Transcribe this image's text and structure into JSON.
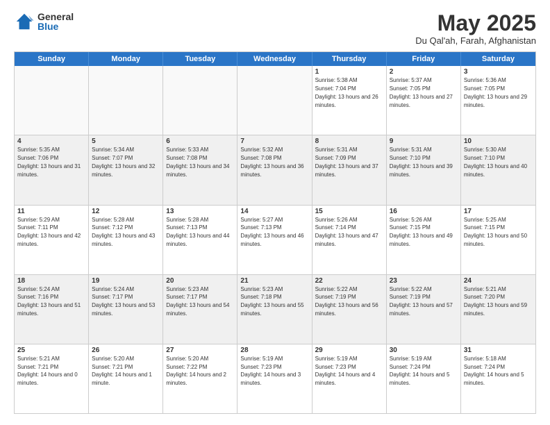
{
  "logo": {
    "general": "General",
    "blue": "Blue"
  },
  "title": "May 2025",
  "location": "Du Qal'ah, Farah, Afghanistan",
  "days": [
    "Sunday",
    "Monday",
    "Tuesday",
    "Wednesday",
    "Thursday",
    "Friday",
    "Saturday"
  ],
  "weeks": [
    [
      {
        "day": "",
        "empty": true
      },
      {
        "day": "",
        "empty": true
      },
      {
        "day": "",
        "empty": true
      },
      {
        "day": "",
        "empty": true
      },
      {
        "day": "1",
        "sunrise": "5:38 AM",
        "sunset": "7:04 PM",
        "daylight": "13 hours and 26 minutes."
      },
      {
        "day": "2",
        "sunrise": "5:37 AM",
        "sunset": "7:05 PM",
        "daylight": "13 hours and 27 minutes."
      },
      {
        "day": "3",
        "sunrise": "5:36 AM",
        "sunset": "7:05 PM",
        "daylight": "13 hours and 29 minutes."
      }
    ],
    [
      {
        "day": "4",
        "sunrise": "5:35 AM",
        "sunset": "7:06 PM",
        "daylight": "13 hours and 31 minutes."
      },
      {
        "day": "5",
        "sunrise": "5:34 AM",
        "sunset": "7:07 PM",
        "daylight": "13 hours and 32 minutes."
      },
      {
        "day": "6",
        "sunrise": "5:33 AM",
        "sunset": "7:08 PM",
        "daylight": "13 hours and 34 minutes."
      },
      {
        "day": "7",
        "sunrise": "5:32 AM",
        "sunset": "7:08 PM",
        "daylight": "13 hours and 36 minutes."
      },
      {
        "day": "8",
        "sunrise": "5:31 AM",
        "sunset": "7:09 PM",
        "daylight": "13 hours and 37 minutes."
      },
      {
        "day": "9",
        "sunrise": "5:31 AM",
        "sunset": "7:10 PM",
        "daylight": "13 hours and 39 minutes."
      },
      {
        "day": "10",
        "sunrise": "5:30 AM",
        "sunset": "7:10 PM",
        "daylight": "13 hours and 40 minutes."
      }
    ],
    [
      {
        "day": "11",
        "sunrise": "5:29 AM",
        "sunset": "7:11 PM",
        "daylight": "13 hours and 42 minutes."
      },
      {
        "day": "12",
        "sunrise": "5:28 AM",
        "sunset": "7:12 PM",
        "daylight": "13 hours and 43 minutes."
      },
      {
        "day": "13",
        "sunrise": "5:28 AM",
        "sunset": "7:13 PM",
        "daylight": "13 hours and 44 minutes."
      },
      {
        "day": "14",
        "sunrise": "5:27 AM",
        "sunset": "7:13 PM",
        "daylight": "13 hours and 46 minutes."
      },
      {
        "day": "15",
        "sunrise": "5:26 AM",
        "sunset": "7:14 PM",
        "daylight": "13 hours and 47 minutes."
      },
      {
        "day": "16",
        "sunrise": "5:26 AM",
        "sunset": "7:15 PM",
        "daylight": "13 hours and 49 minutes."
      },
      {
        "day": "17",
        "sunrise": "5:25 AM",
        "sunset": "7:15 PM",
        "daylight": "13 hours and 50 minutes."
      }
    ],
    [
      {
        "day": "18",
        "sunrise": "5:24 AM",
        "sunset": "7:16 PM",
        "daylight": "13 hours and 51 minutes."
      },
      {
        "day": "19",
        "sunrise": "5:24 AM",
        "sunset": "7:17 PM",
        "daylight": "13 hours and 53 minutes."
      },
      {
        "day": "20",
        "sunrise": "5:23 AM",
        "sunset": "7:17 PM",
        "daylight": "13 hours and 54 minutes."
      },
      {
        "day": "21",
        "sunrise": "5:23 AM",
        "sunset": "7:18 PM",
        "daylight": "13 hours and 55 minutes."
      },
      {
        "day": "22",
        "sunrise": "5:22 AM",
        "sunset": "7:19 PM",
        "daylight": "13 hours and 56 minutes."
      },
      {
        "day": "23",
        "sunrise": "5:22 AM",
        "sunset": "7:19 PM",
        "daylight": "13 hours and 57 minutes."
      },
      {
        "day": "24",
        "sunrise": "5:21 AM",
        "sunset": "7:20 PM",
        "daylight": "13 hours and 59 minutes."
      }
    ],
    [
      {
        "day": "25",
        "sunrise": "5:21 AM",
        "sunset": "7:21 PM",
        "daylight": "14 hours and 0 minutes."
      },
      {
        "day": "26",
        "sunrise": "5:20 AM",
        "sunset": "7:21 PM",
        "daylight": "14 hours and 1 minute."
      },
      {
        "day": "27",
        "sunrise": "5:20 AM",
        "sunset": "7:22 PM",
        "daylight": "14 hours and 2 minutes."
      },
      {
        "day": "28",
        "sunrise": "5:19 AM",
        "sunset": "7:23 PM",
        "daylight": "14 hours and 3 minutes."
      },
      {
        "day": "29",
        "sunrise": "5:19 AM",
        "sunset": "7:23 PM",
        "daylight": "14 hours and 4 minutes."
      },
      {
        "day": "30",
        "sunrise": "5:19 AM",
        "sunset": "7:24 PM",
        "daylight": "14 hours and 5 minutes."
      },
      {
        "day": "31",
        "sunrise": "5:18 AM",
        "sunset": "7:24 PM",
        "daylight": "14 hours and 5 minutes."
      }
    ]
  ]
}
